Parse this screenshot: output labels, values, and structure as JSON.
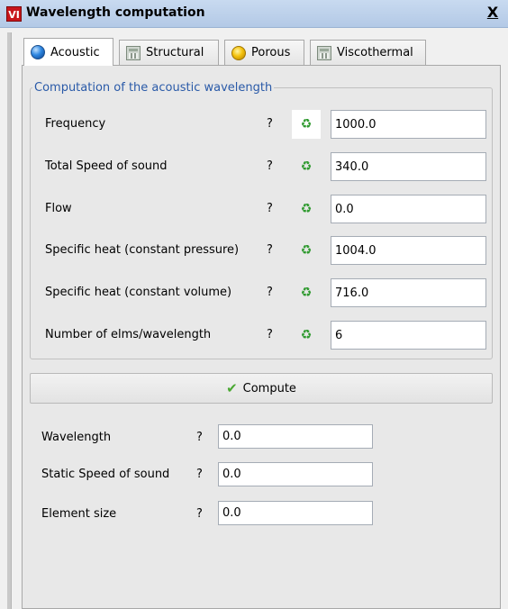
{
  "window": {
    "app_icon": "VI",
    "title": "Wavelength computation",
    "close_label": "X"
  },
  "tabs": [
    {
      "label": "Acoustic",
      "icon": "globe-icon",
      "active": true
    },
    {
      "label": "Structural",
      "icon": "calculator-icon",
      "active": false
    },
    {
      "label": "Porous",
      "icon": "sphere-icon",
      "active": false
    },
    {
      "label": "Viscothermal",
      "icon": "calculator-icon",
      "active": false
    }
  ],
  "group": {
    "title": "Computation of the acoustic wavelength",
    "rows": [
      {
        "label": "Frequency",
        "help": "?",
        "value": "1000.0"
      },
      {
        "label": "Total Speed of sound",
        "help": "?",
        "value": "340.0"
      },
      {
        "label": "Flow",
        "help": "?",
        "value": "0.0"
      },
      {
        "label": "Specific heat (constant pressure)",
        "help": "?",
        "value": "1004.0"
      },
      {
        "label": "Specific heat (constant volume)",
        "help": "?",
        "value": "716.0"
      },
      {
        "label": "Number of elms/wavelength",
        "help": "?",
        "value": "6"
      }
    ]
  },
  "compute": {
    "label": "Compute",
    "icon": "check-icon"
  },
  "results": [
    {
      "label": "Wavelength",
      "help": "?",
      "value": "0.0"
    },
    {
      "label": "Static Speed of sound",
      "help": "?",
      "value": "0.0"
    },
    {
      "label": "Element size",
      "help": "?",
      "value": "0.0"
    }
  ],
  "colors": {
    "accent_text": "#2a5aa8",
    "refresh_icon": "#2f9a2f",
    "check_icon": "#4aa832",
    "app_icon_bg": "#c8151b"
  }
}
